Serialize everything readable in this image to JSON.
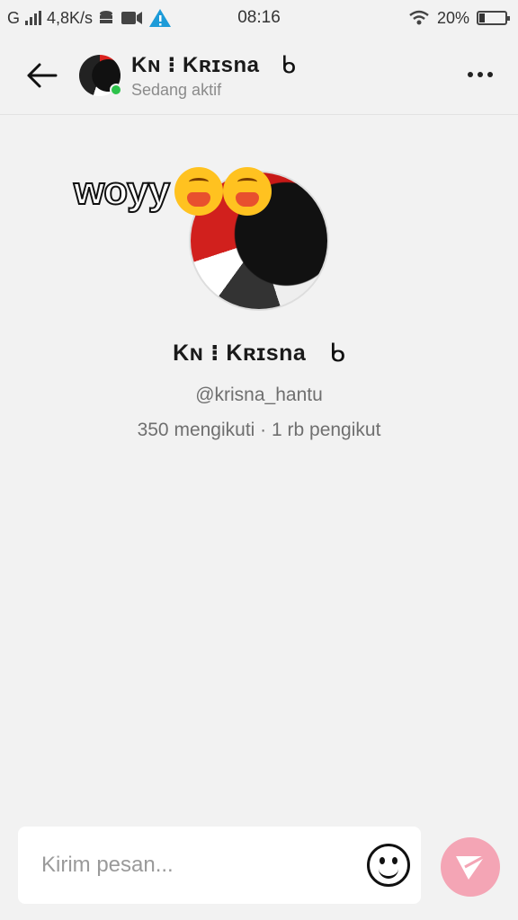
{
  "status_bar": {
    "network": "G",
    "speed": "4,8K/s",
    "time": "08:16",
    "battery": "20%",
    "battery_level": 0.2
  },
  "header": {
    "name": "Kɴ ⁝ Kʀɪsna",
    "status": "Sedang aktif",
    "decoration": "ᑲ"
  },
  "profile": {
    "sticker_text": "woyy",
    "name": "Kɴ ⁝ Kʀɪsna",
    "decoration": "ᑲ",
    "handle": "@krisna_hantu",
    "stats": "350 mengikuti · 1 rb pengikut"
  },
  "composer": {
    "placeholder": "Kirim pesan..."
  },
  "colors": {
    "online": "#2cc24a",
    "send_button": "#f4a5b5"
  },
  "icons": {
    "back": "arrow-left-icon",
    "more": "more-horizontal-icon",
    "emoji": "smiley-icon",
    "send": "send-icon"
  }
}
